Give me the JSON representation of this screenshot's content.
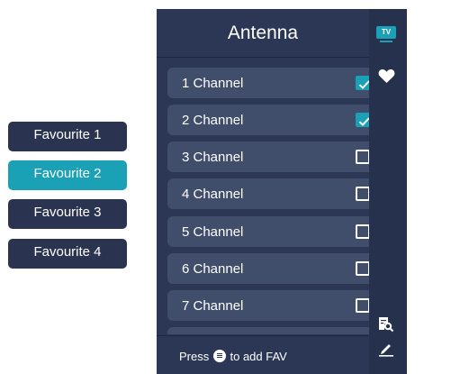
{
  "favourites": [
    {
      "label": "Favourite 1",
      "active": false
    },
    {
      "label": "Favourite 2",
      "active": true
    },
    {
      "label": "Favourite 3",
      "active": false
    },
    {
      "label": "Favourite 4",
      "active": false
    }
  ],
  "panel": {
    "title": "Antenna",
    "channels": [
      {
        "label": "1 Channel",
        "checked": true
      },
      {
        "label": "2 Channel",
        "checked": true
      },
      {
        "label": "3 Channel",
        "checked": false
      },
      {
        "label": "4 Channel",
        "checked": false
      },
      {
        "label": "5 Channel",
        "checked": false
      },
      {
        "label": "6 Channel",
        "checked": false
      },
      {
        "label": "7 Channel",
        "checked": false
      }
    ],
    "hint_prefix": "Press",
    "hint_suffix": "to add FAV"
  },
  "side_icons": {
    "tv_label": "TV",
    "items": [
      "tv-icon",
      "heart-icon",
      "search-document-icon",
      "edit-icon"
    ]
  },
  "colors": {
    "panel": "#2b3755",
    "row": "#404d6b",
    "accent": "#1aa1b5",
    "favourite_button": "#2a3450"
  }
}
